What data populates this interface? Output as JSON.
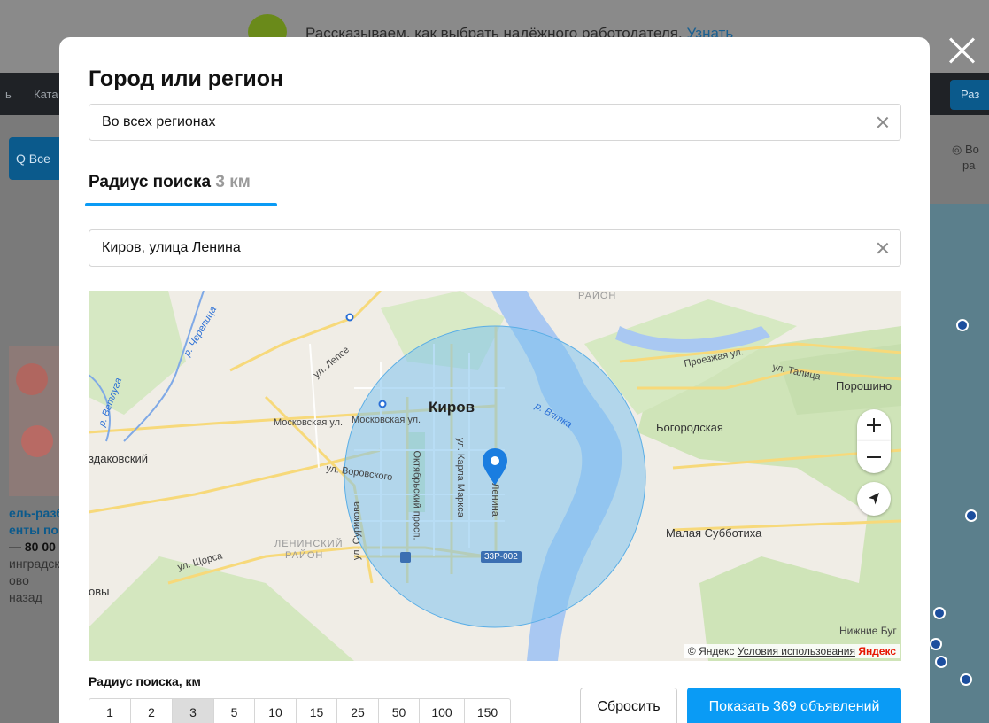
{
  "background": {
    "banner_text": "Рассказываем, как выбрать надёжного работодателя.",
    "banner_link": "Узнать",
    "nav_item_1": "ь",
    "nav_item_2": "Ката",
    "nav_button": "Раз",
    "search_button": "Q Все",
    "location_line1": "Во",
    "location_line2": "ра",
    "card": {
      "line1": "ель-разб",
      "line2": "енты по",
      "line3": "— 80 00",
      "line4": "инградск",
      "line5": "ово",
      "line6": "назад"
    }
  },
  "modal": {
    "title": "Город или регион",
    "region_field": {
      "value": "Во всех регионах"
    },
    "tab": {
      "label": "Радиус поиска",
      "value": "3 км"
    },
    "address_field": {
      "value": "Киров, улица Ленина"
    },
    "map": {
      "labels": {
        "city": "Киров",
        "raion_top": "РАЙОН",
        "proezzhaya": "Проезжая ул.",
        "talitsa": "ул. Талица",
        "poroshino": "Порошино",
        "bogorodskaya": "Богородская",
        "vyatka": "р. Вятка",
        "moskovskaya1": "Московская ул.",
        "moskovskaya2": "Московская ул.",
        "lepse": "ул. Лепсе",
        "cherepitsa": "р. Черепица",
        "vetluga": "р. Ветлуга",
        "zdakovsky": "здаковский",
        "vorovskogo": "ул. Воровского",
        "oktyabrsky": "Октябрьский просп.",
        "karla_marksa": "ул. Карла Маркса",
        "lenina": "Ленина",
        "surikova": "ул. Сурикова",
        "leninsky1": "ЛЕНИНСКИЙ",
        "leninsky2": "РАЙОН",
        "shchorsa": "ул. Щорса",
        "ovy": "овы",
        "malaya_subbotikha": "Малая Субботиха",
        "nizhnie_bug": "Нижние Буг",
        "road_badge": "33Р-002"
      },
      "attribution": {
        "copyright": "© Яндекс",
        "terms": "Условия использования",
        "brand": "Яндекс"
      }
    },
    "radius_label": "Радиус поиска, км",
    "radius_options": [
      "1",
      "2",
      "3",
      "5",
      "10",
      "15",
      "25",
      "50",
      "100",
      "150"
    ],
    "radius_selected": "3",
    "reset_button": "Сбросить",
    "show_button": "Показать 369 объявлений"
  },
  "colors": {
    "accent": "#0a9bf5",
    "circle_fill": "#7fc3ee",
    "pin": "#1a7de0",
    "river": "#a9c8f2",
    "park": "#cde5b5"
  }
}
